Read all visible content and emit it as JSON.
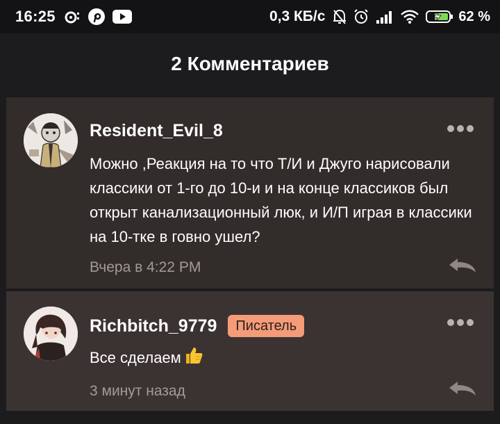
{
  "status_bar": {
    "time": "16:25",
    "speed": "0,3 КБ/с",
    "battery": "62 %"
  },
  "header": {
    "title": "2 Комментариев"
  },
  "comments": [
    {
      "author": "Resident_Evil_8",
      "badge": "",
      "text": "Можно ,Реакция на то что Т/И и Джуго нарисовали классики от 1-го до 10-и и на конце классиков был открыт канализационный люк, и И/П играя в классики на 10-тке в говно ушел?",
      "time": "Вчера в 4:22 PM"
    },
    {
      "author": "Richbitch_9779",
      "badge": "Писатель",
      "text": "Все сделаем",
      "time": "3 минут назад"
    }
  ],
  "colors": {
    "accent_badge": "#f49b7a",
    "card_1": "#322c2a",
    "card_2": "#3b3331",
    "background": "#1c1b1e",
    "muted_text": "#a29b98"
  },
  "icons": {
    "more": "more-dots-icon",
    "reply": "reply-icon",
    "thumb": "thumbs-up-icon"
  }
}
